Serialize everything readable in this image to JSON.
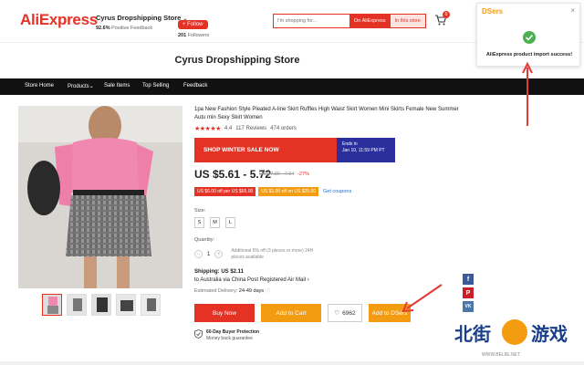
{
  "header": {
    "logo": "AliExpress",
    "store_name": "Cyrus Dropshipping Store",
    "store_caret": "⌄",
    "positive_feedback_pct": "92.6%",
    "positive_feedback_label": "Positive Feedback",
    "follow_label": "+ Follow",
    "followers_count": "201",
    "followers_label": "Followers",
    "search_placeholder": "I'm shopping for...",
    "search_ae_label": "On AliExpress",
    "search_store_label": "In this store",
    "cart_count": "0"
  },
  "store_title": "Cyrus Dropshipping Store",
  "nav": {
    "items": [
      "Store Home",
      "Products",
      "Sale Items",
      "Top Selling",
      "Feedback"
    ]
  },
  "product": {
    "title": "1pa New Fashion Style Pleated A-line Skirt Ruffles High Waist Skirt Women Mini Skirts Female New Summer Autu min Sexy Skirt Women",
    "stars": "★★★★★",
    "rating": "4.4",
    "reviews": "117 Reviews",
    "orders": "474 orders",
    "sale_banner": "SHOP WINTER SALE NOW",
    "sale_ends_label": "Ends in",
    "sale_ends_date": "Jan 10, 11:59 PM PT",
    "price": "US $5.61 - 5.72",
    "old_price": "US $7.80 - 7.94",
    "discount": "-27%",
    "coupon1": "US $6.00 off per US $65.00",
    "coupon2": "US $1.00 off on US $25.00",
    "get_coupons": "Get coupons",
    "size_label": "Size:",
    "sizes": [
      "S",
      "M",
      "L"
    ],
    "quantity_label": "Quantity:",
    "quantity": "1",
    "quantity_note": "Additional 5% off (3 pieces or more) 24H pieces available",
    "shipping_label": "Shipping: US $2.11",
    "shipping_detail": "to Australia via China Post Registered Air Mail ›",
    "delivery_label": "Estimated Delivery:",
    "delivery_days": "24-49 days",
    "buy_now": "Buy Now",
    "add_to_cart": "Add to Cart",
    "wishlist_count": "6962",
    "add_to_dsers": "Add to DSers",
    "protection_title": "60-Day Buyer Protection",
    "protection_sub": "Money back guarantee"
  },
  "popup": {
    "logo": "DSers",
    "close": "×",
    "message": "AliExpress product import success!"
  },
  "social": [
    "f",
    "P",
    "VK"
  ],
  "watermark": {
    "left": "北街",
    "right": "游戏",
    "url": "WWW.BEIJIE.NET"
  },
  "colors": {
    "brand_red": "#e43225",
    "accent_orange": "#f39c12",
    "nav_bg": "#111111",
    "sale_blue": "#2b2f9e",
    "success_green": "#4caf50"
  }
}
